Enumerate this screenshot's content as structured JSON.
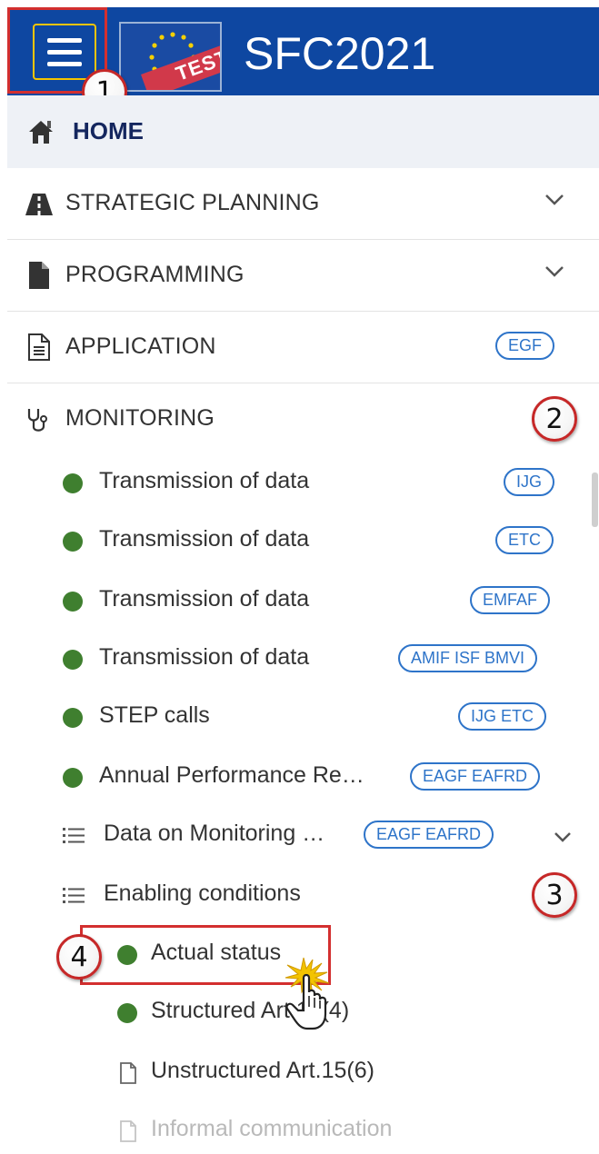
{
  "header": {
    "app_title": "SFC2021",
    "logo_ribbon_text": "TEST",
    "menu_icon": "hamburger-icon",
    "brand_color": "#0e47a1",
    "ribbon_color": "#d1394a"
  },
  "home": {
    "label": "HOME",
    "icon": "home-icon"
  },
  "menu": [
    {
      "label": "STRATEGIC PLANNING",
      "icon": "road-icon"
    },
    {
      "label": "PROGRAMMING",
      "icon": "file-icon"
    },
    {
      "label": "APPLICATION",
      "icon": "document-icon",
      "badge": "EGF"
    },
    {
      "label": "MONITORING",
      "icon": "stethoscope-icon"
    }
  ],
  "monitoring_items": [
    {
      "label": "Transmission of data",
      "badge": "IJG"
    },
    {
      "label": "Transmission of data",
      "badge": "ETC"
    },
    {
      "label": "Transmission of data",
      "badge": "EMFAF"
    },
    {
      "label": "Transmission of data",
      "badge": "AMIF ISF BMVI"
    },
    {
      "label": "STEP calls",
      "badge": "IJG ETC"
    },
    {
      "label": "Annual Performance Re…",
      "badge": "EAGF EAFRD"
    },
    {
      "label": "Data on Monitoring …",
      "badge": "EAGF EAFRD"
    },
    {
      "label": "Enabling conditions"
    }
  ],
  "enabling_items": [
    {
      "label": "Actual status"
    },
    {
      "label": "Structured Art.15(4)"
    },
    {
      "label": "Unstructured Art.15(6)"
    },
    {
      "label": "Informal communication"
    }
  ],
  "callouts": [
    "1",
    "2",
    "3",
    "4"
  ],
  "colors": {
    "status_green": "#3f7f2f",
    "badge_blue": "#2e74c9",
    "highlight_red": "#d32f2f"
  }
}
